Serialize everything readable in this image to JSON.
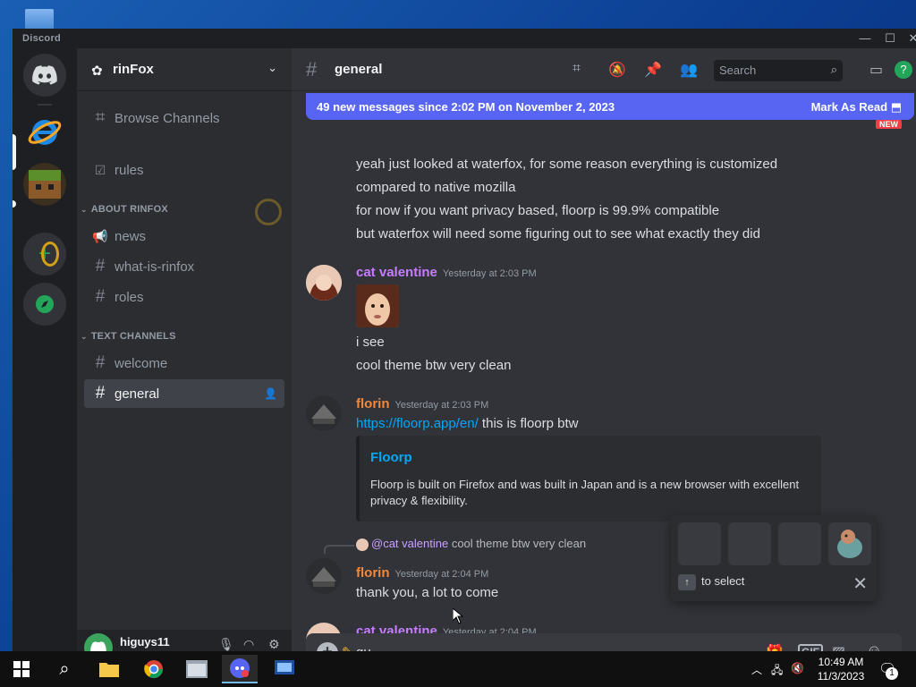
{
  "window": {
    "title": "Discord"
  },
  "guild": {
    "name": "rinFox"
  },
  "sidebar": {
    "browse": "Browse Channels",
    "rules": "rules",
    "cat_about": "ABOUT RINFOX",
    "about_channels": [
      "news",
      "what-is-rinfox",
      "roles"
    ],
    "cat_text": "TEXT CHANNELS",
    "text_channels": [
      "welcome",
      "general"
    ]
  },
  "user": {
    "name": "higuys11"
  },
  "header": {
    "channel": "general",
    "search_placeholder": "Search"
  },
  "new_banner": {
    "text": "49 new messages since 2:02 PM on November 2, 2023",
    "mark": "Mark As Read",
    "pill": "NEW"
  },
  "messages": {
    "m0": [
      "yeah just looked at waterfox, for some reason everything is customized",
      "compared to native mozilla",
      "for now if you want privacy based, floorp is 99.9% compatible",
      "but waterfox will need some figuring out to see what exactly they did"
    ],
    "m1": {
      "author": "cat valentine",
      "time": "Yesterday at 2:03 PM",
      "lines": [
        "i see",
        "cool theme btw very clean"
      ]
    },
    "m2": {
      "author": "florin",
      "time": "Yesterday at 2:03 PM",
      "link": "https://floorp.app/en/",
      "text": " this is floorp btw",
      "embed": {
        "title": "Floorp",
        "desc": "Floorp is built on Firefox and was built in Japan and is a new browser with excellent privacy & flexibility."
      }
    },
    "m3": {
      "reply_mention": "@cat valentine",
      "reply_text": "cool theme btw very clean",
      "author": "florin",
      "time": "Yesterday at 2:04 PM",
      "text": "thank you, a lot to come"
    },
    "m4": {
      "author": "cat valentine",
      "time": "Yesterday at 2:04 PM"
    }
  },
  "composer": {
    "value": "gu"
  },
  "popup": {
    "hint": "to select"
  },
  "taskbar": {
    "time": "10:49 AM",
    "date": "11/3/2023",
    "notif": "1"
  },
  "colors": {
    "accent": "#5865f2",
    "purple_name": "#c77dff",
    "orange_name": "#f0883e"
  }
}
